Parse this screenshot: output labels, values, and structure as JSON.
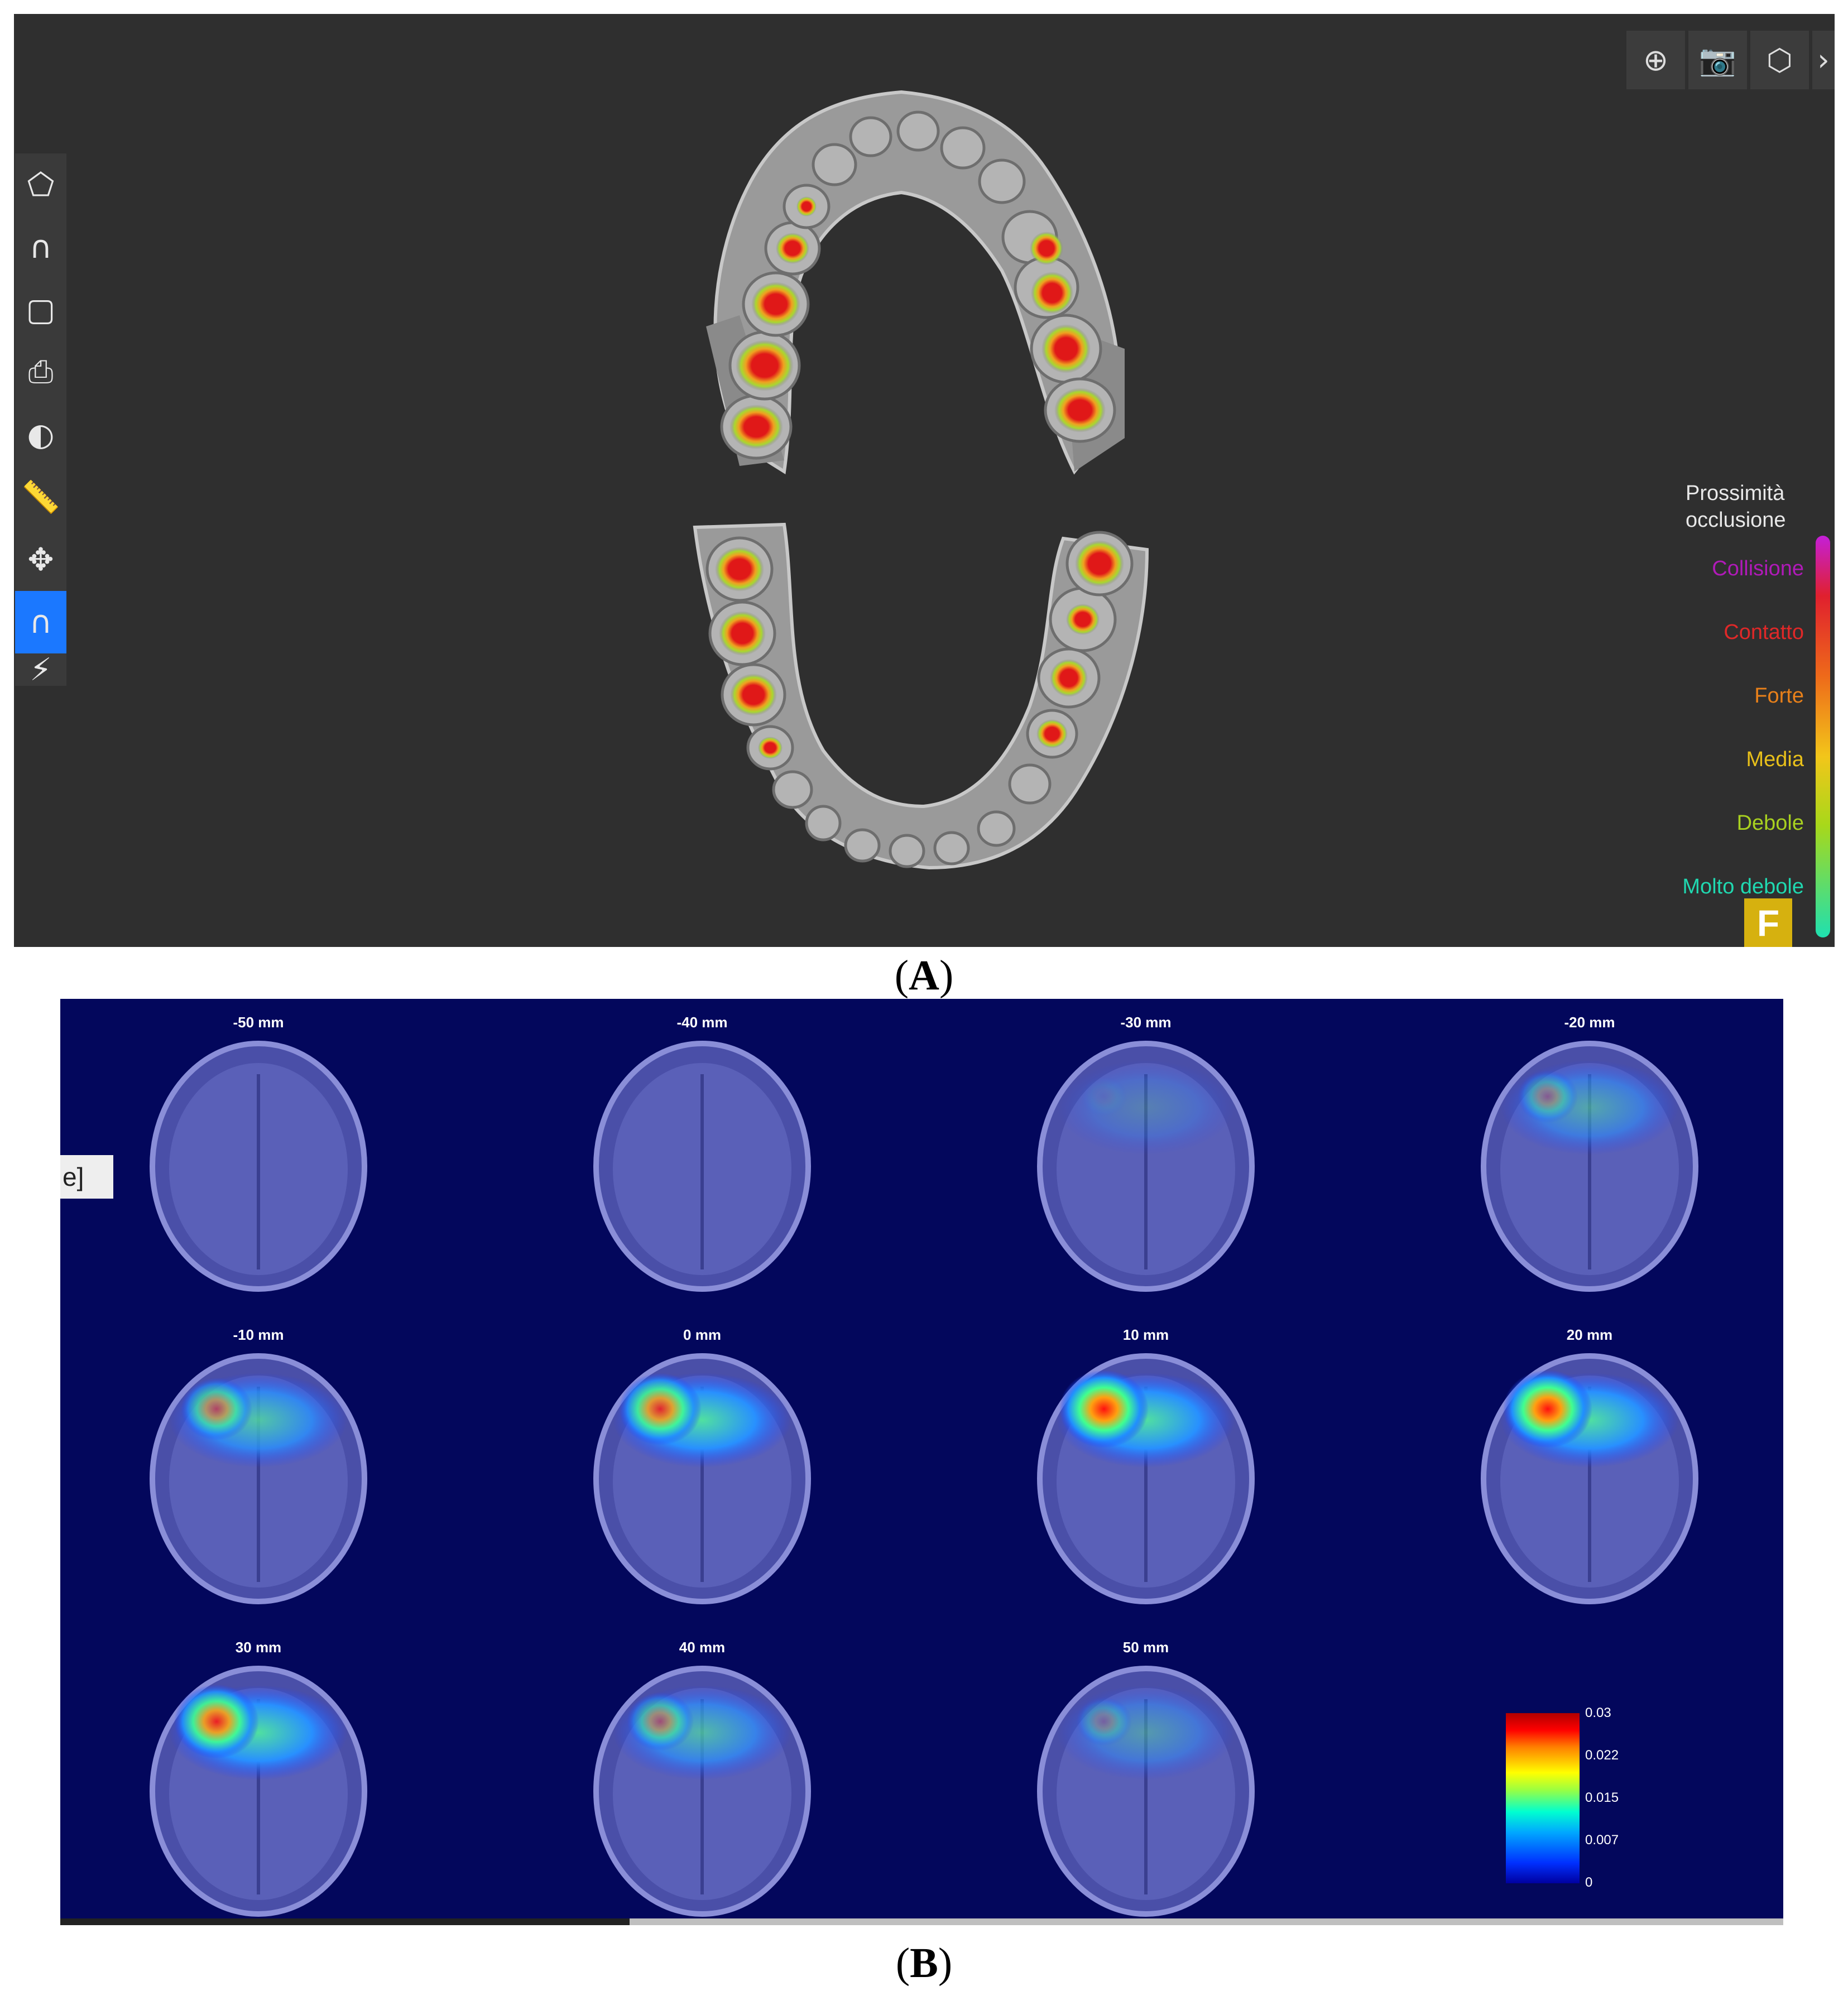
{
  "panel_a": {
    "top_toolbar": [
      {
        "name": "zoom-icon",
        "glyph": "⊕"
      },
      {
        "name": "camera-icon",
        "glyph": "📷"
      },
      {
        "name": "view-cube-icon",
        "glyph": "⬡"
      },
      {
        "name": "collapse-chevron-icon",
        "glyph": "›"
      }
    ],
    "left_toolbar": [
      {
        "name": "lasso-select-icon",
        "glyph": "⬠"
      },
      {
        "name": "arch-icon",
        "glyph": "∩"
      },
      {
        "name": "tooth-icon",
        "glyph": "▢"
      },
      {
        "name": "snapshot-icon",
        "glyph": "⎙"
      },
      {
        "name": "texture-toggle-icon",
        "glyph": "◐"
      },
      {
        "name": "measure-ruler-icon",
        "glyph": "📏"
      },
      {
        "name": "orbit-icon",
        "glyph": "✥"
      },
      {
        "name": "occlusion-map-icon",
        "glyph": "∩"
      },
      {
        "name": "more-tools-icon",
        "glyph": "⚡"
      }
    ],
    "legend": {
      "title_line1": "Prossimità",
      "title_line2": "occlusione",
      "items": [
        {
          "label": "Collisione",
          "color": "#b01ab8"
        },
        {
          "label": "Contatto",
          "color": "#e02828"
        },
        {
          "label": "Forte",
          "color": "#e8801a"
        },
        {
          "label": "Media",
          "color": "#e8c01a"
        },
        {
          "label": "Debole",
          "color": "#a8d020"
        },
        {
          "label": "Molto debole",
          "color": "#20d8b0"
        }
      ]
    },
    "badge": "F",
    "caption_letter": "A"
  },
  "panel_b": {
    "partial_tab_text": "e]",
    "slices": [
      {
        "label": "-50 mm",
        "intensity": 0.0
      },
      {
        "label": "-40 mm",
        "intensity": 0.0
      },
      {
        "label": "-30 mm",
        "intensity": 0.05
      },
      {
        "label": "-20 mm",
        "intensity": 0.35
      },
      {
        "label": "-10 mm",
        "intensity": 0.6
      },
      {
        "label": "0 mm",
        "intensity": 0.85
      },
      {
        "label": "10 mm",
        "intensity": 1.0
      },
      {
        "label": "20 mm",
        "intensity": 1.0
      },
      {
        "label": "30 mm",
        "intensity": 0.9
      },
      {
        "label": "40 mm",
        "intensity": 0.5
      },
      {
        "label": "50 mm",
        "intensity": 0.25
      }
    ],
    "colorbar_ticks": [
      "0.03",
      "0.022",
      "0.015",
      "0.007",
      "0"
    ],
    "caption_letter": "B"
  }
}
